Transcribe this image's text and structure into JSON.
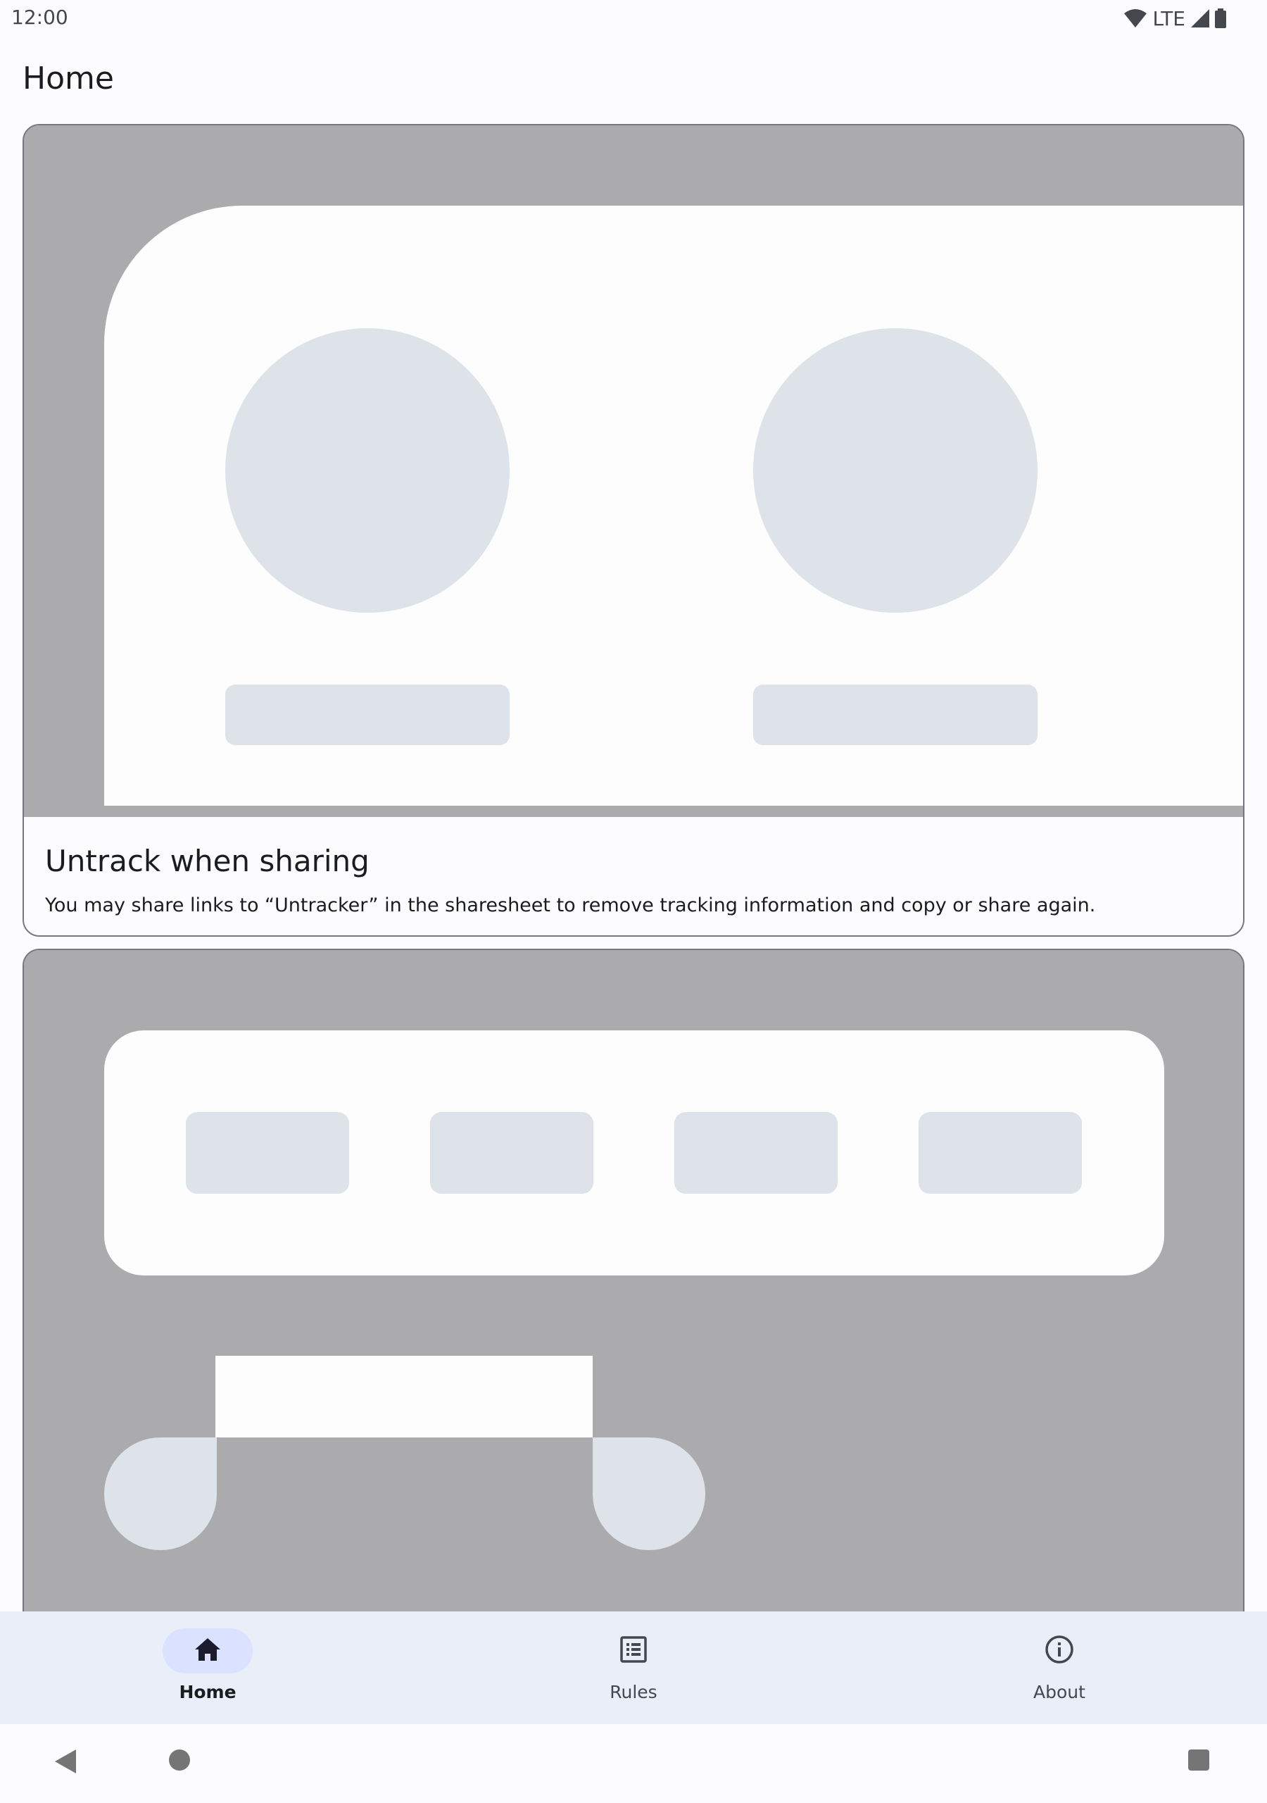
{
  "status_bar": {
    "time": "12:00",
    "network": "LTE",
    "icons": [
      "wifi-icon",
      "cell-signal-icon",
      "battery-icon"
    ]
  },
  "page": {
    "title": "Home"
  },
  "cards": [
    {
      "title": "Untrack when sharing",
      "body": "You may share links to “Untracker” in the sharesheet to remove tracking information and copy or share again."
    }
  ],
  "bottom_nav": {
    "items": [
      {
        "label": "Home",
        "icon": "home-icon",
        "selected": true
      },
      {
        "label": "Rules",
        "icon": "list-icon",
        "selected": false
      },
      {
        "label": "About",
        "icon": "info-icon",
        "selected": false
      }
    ]
  },
  "system_nav": {
    "icons": [
      "back-icon",
      "home-circle-icon",
      "recents-icon"
    ]
  },
  "colors": {
    "background": "#fcfcff",
    "illustration_gray": "#ababad",
    "placeholder": "#dde3e8",
    "nav_background": "#e9eef9",
    "nav_indicator": "#dae2ff"
  }
}
